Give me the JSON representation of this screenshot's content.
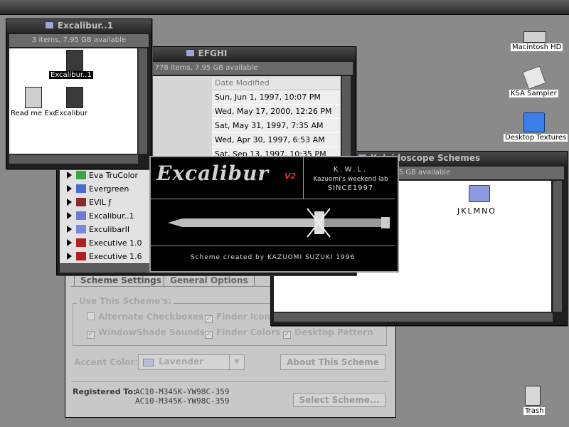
{
  "windows": {
    "excalibur_folder": {
      "title": "Excalibur..1",
      "info": "3 items, 7.95 GB available"
    },
    "efghi": {
      "title": "EFGHI",
      "info": "778 items, 7.95 GB available",
      "column_header": "Date Modified"
    },
    "schemes": {
      "title": "Kaleidoscope Schemes",
      "info": "7.95 GB available"
    }
  },
  "excalibur_icons": [
    "Excalibur..1",
    "Read me Exc",
    "Excalibur"
  ],
  "dates": [
    "Sun, Jun 1, 1997, 10:07 PM",
    "Wed, May 17, 2000, 12:26 PM",
    "Sat, May 31, 1997, 7:35 AM",
    "Wed, Apr 30, 1997, 6:53 AM",
    "Sat, Sep 13, 1997, 10:35 PM"
  ],
  "file_list": [
    "Eva TruColor Ser",
    "Evergreen",
    "EVIL ƒ",
    "Excalibur..1",
    "ExculibarII Folde",
    "Executive 1.0 Be",
    "Executive 1.6"
  ],
  "folder_icon_label": "JKLMNO",
  "splash": {
    "logo": "Excalibur",
    "version": "V2",
    "brand": "K.W.L.",
    "line1": "Kazuomi's weekend lab",
    "line2": "SINCE1997",
    "credit": "Scheme created by KAZUOMI SUZUKI 1996"
  },
  "panel": {
    "tabs": [
      "Scheme Settings",
      "General Options"
    ],
    "group_label": "Use This Scheme's:",
    "options": {
      "alt_checkboxes": {
        "label": "Alternate Checkboxes",
        "checked": false
      },
      "finder_icons": {
        "label": "Finder Icons",
        "checked": true
      },
      "windowshade": {
        "label": "WindowShade Sounds",
        "checked": true
      },
      "finder_colors": {
        "label": "Finder Colors",
        "checked": true
      },
      "desktop_pattern": {
        "label": "Desktop Pattern",
        "checked": true
      }
    },
    "accent_label": "Accent Color:",
    "accent_value": "Lavender",
    "about_button": "About This Scheme",
    "registered_label": "Registered To:",
    "registered_values": [
      "AC10-M345K-YW98C-359",
      "AC10-M345K-YW98C-359"
    ],
    "select_button": "Select Scheme..."
  },
  "desktop": {
    "hd": "Macintosh HD",
    "sampler": "KSA Sampler",
    "textures": "Desktop Textures",
    "trash": "Trash"
  }
}
